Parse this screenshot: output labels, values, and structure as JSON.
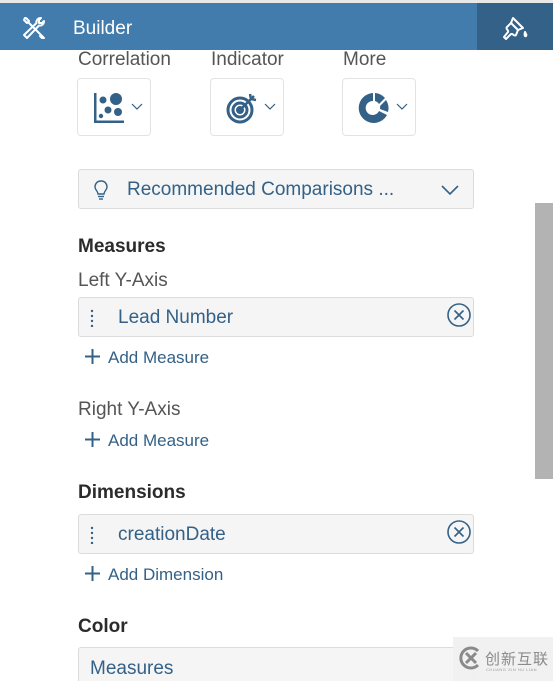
{
  "header": {
    "title": "Builder",
    "left_icon": "tools-icon",
    "right_button_icon": "paintbrush-icon",
    "background_color": "#427cac",
    "active_button_color": "#346187"
  },
  "chart_types": [
    {
      "label": "Correlation",
      "icon": "bubble-scatter-icon"
    },
    {
      "label": "Indicator",
      "icon": "target-icon"
    },
    {
      "label": "More",
      "icon": "donut-chart-icon"
    }
  ],
  "recommended": {
    "icon": "lightbulb-icon",
    "label": "Recommended Comparisons ..."
  },
  "measures": {
    "heading": "Measures",
    "left_axis": {
      "label": "Left Y-Axis",
      "tokens": [
        "Lead Number"
      ],
      "add_label": "Add Measure"
    },
    "right_axis": {
      "label": "Right Y-Axis",
      "tokens": [],
      "add_label": "Add Measure"
    }
  },
  "dimensions": {
    "heading": "Dimensions",
    "tokens": [
      "creationDate"
    ],
    "add_label": "Add Dimension"
  },
  "color": {
    "heading": "Color",
    "value": "Measures"
  },
  "watermark": {
    "text_cn": "创新互联",
    "text_en": "CHUANG XIN HU LIAN"
  },
  "colors": {
    "accent_text": "#346187",
    "icon_blue": "#346187",
    "token_bg": "#f5f5f5",
    "scrollbar": "#b3b3b3"
  }
}
